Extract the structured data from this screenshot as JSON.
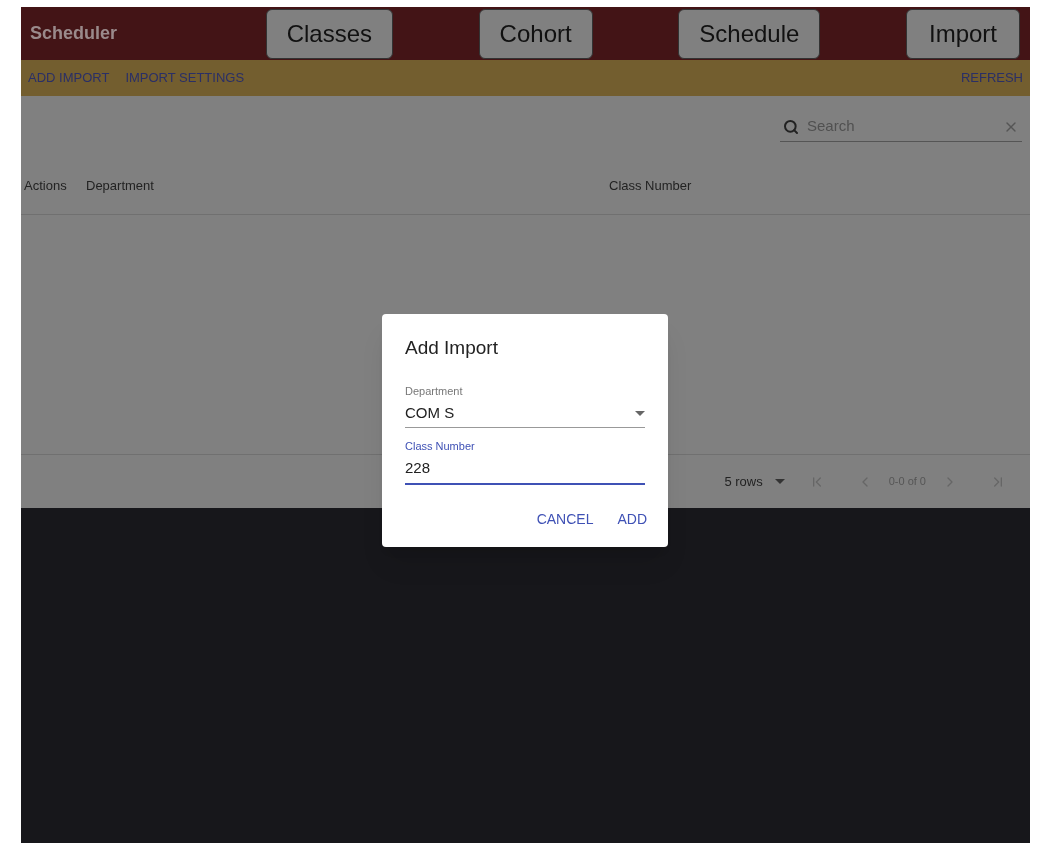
{
  "app_title": "Scheduler",
  "nav_buttons": [
    "Classes",
    "Cohort",
    "Schedule",
    "Import"
  ],
  "toolbar": {
    "left_actions": [
      "ADD IMPORT",
      "IMPORT SETTINGS"
    ],
    "right_actions": [
      "REFRESH"
    ]
  },
  "search": {
    "placeholder": "Search"
  },
  "table": {
    "columns": [
      "Actions",
      "Department",
      "Class Number"
    ]
  },
  "pagination": {
    "rows_per_page": "5 rows",
    "range": "0-0 of 0"
  },
  "dialog": {
    "title": "Add Import",
    "fields": [
      {
        "kind": "select",
        "label": "Department",
        "value": "COM S",
        "focused": false
      },
      {
        "kind": "text",
        "label": "Class Number",
        "value": "228",
        "focused": true
      }
    ],
    "buttons": [
      "CANCEL",
      "ADD"
    ]
  }
}
